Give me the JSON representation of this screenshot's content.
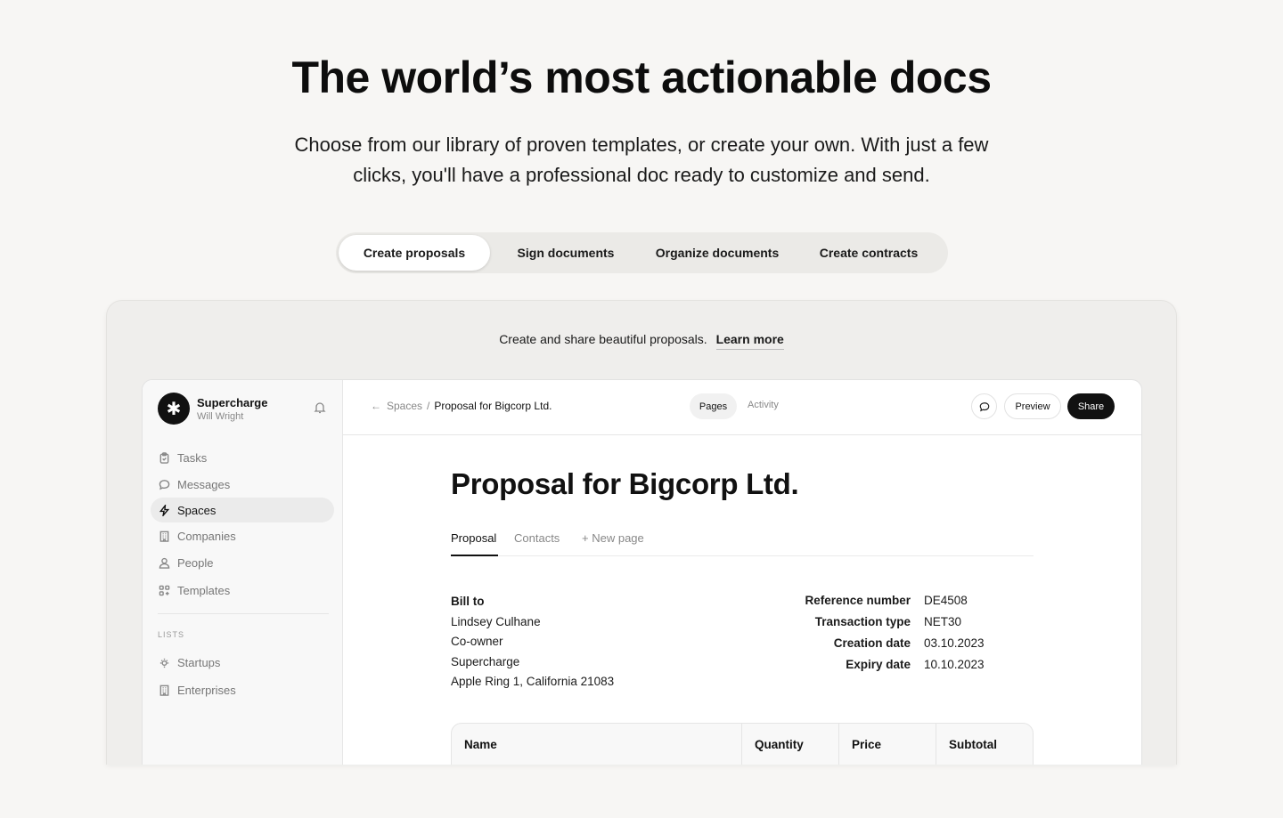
{
  "hero": {
    "title": "The world’s most actionable docs",
    "subtitle": "Choose from our library of proven templates, or create your own. With just a few clicks, you'll have a professional doc ready to customize and send."
  },
  "tabs": [
    {
      "label": "Create proposals",
      "active": true
    },
    {
      "label": "Sign documents",
      "active": false
    },
    {
      "label": "Organize documents",
      "active": false
    },
    {
      "label": "Create contracts",
      "active": false
    }
  ],
  "showcase": {
    "caption": "Create and share beautiful proposals.",
    "learn_more": "Learn more"
  },
  "sidebar": {
    "workspace_name": "Supercharge",
    "user_name": "Will Wright",
    "items": [
      {
        "label": "Tasks",
        "icon": "clipboard-icon"
      },
      {
        "label": "Messages",
        "icon": "chat-icon"
      },
      {
        "label": "Spaces",
        "icon": "bolt-icon",
        "active": true
      },
      {
        "label": "Companies",
        "icon": "building-icon"
      },
      {
        "label": "People",
        "icon": "people-icon"
      },
      {
        "label": "Templates",
        "icon": "grid-icon"
      }
    ],
    "lists_label": "LISTS",
    "lists": [
      {
        "label": "Startups",
        "icon": "sun-icon"
      },
      {
        "label": "Enterprises",
        "icon": "building-icon"
      }
    ]
  },
  "topbar": {
    "breadcrumb_root": "Spaces",
    "breadcrumb_sep": "/",
    "breadcrumb_current": "Proposal for Bigcorp Ltd.",
    "pages_label": "Pages",
    "activity_label": "Activity",
    "preview_label": "Preview",
    "share_label": "Share"
  },
  "doc": {
    "title": "Proposal for Bigcorp Ltd.",
    "tabs": [
      "Proposal",
      "Contacts",
      "New page"
    ],
    "bill_to": {
      "heading": "Bill to",
      "lines": [
        "Lindsey Culhane",
        "Co-owner",
        "Supercharge",
        "Apple Ring 1, California 21083"
      ]
    },
    "meta": [
      {
        "key": "Reference number",
        "value": "DE4508"
      },
      {
        "key": "Transaction type",
        "value": "NET30"
      },
      {
        "key": "Creation date",
        "value": "03.10.2023"
      },
      {
        "key": "Expiry date",
        "value": "10.10.2023"
      }
    ],
    "table_headers": [
      "Name",
      "Quantity",
      "Price",
      "Subtotal"
    ]
  }
}
